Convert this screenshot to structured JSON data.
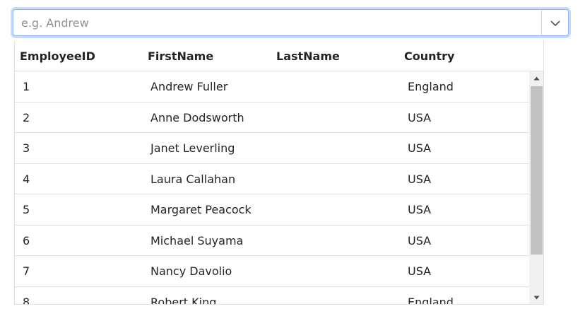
{
  "combobox": {
    "placeholder": "e.g. Andrew",
    "value": ""
  },
  "grid": {
    "columns": [
      "EmployeeID",
      "FirstName",
      "LastName",
      "Country"
    ],
    "rows": [
      {
        "id": "1",
        "name": "Andrew Fuller",
        "country": "England"
      },
      {
        "id": "2",
        "name": "Anne Dodsworth",
        "country": "USA"
      },
      {
        "id": "3",
        "name": "Janet Leverling",
        "country": "USA"
      },
      {
        "id": "4",
        "name": "Laura Callahan",
        "country": "USA"
      },
      {
        "id": "5",
        "name": "Margaret Peacock",
        "country": "USA"
      },
      {
        "id": "6",
        "name": "Michael Suyama",
        "country": "USA"
      },
      {
        "id": "7",
        "name": "Nancy Davolio",
        "country": "USA"
      },
      {
        "id": "8",
        "name": "Robert King",
        "country": "England"
      }
    ]
  },
  "icons": {
    "dropdown": "chevron-down-icon",
    "scroll_up": "scroll-up-arrow-icon",
    "scroll_down": "scroll-down-arrow-icon"
  },
  "colors": {
    "focus_border": "#86b7fe",
    "focus_ring": "#c7dcfb",
    "row_border": "#dee2e6",
    "scroll_track": "#f1f1f1",
    "scroll_thumb": "#c1c1c1"
  }
}
